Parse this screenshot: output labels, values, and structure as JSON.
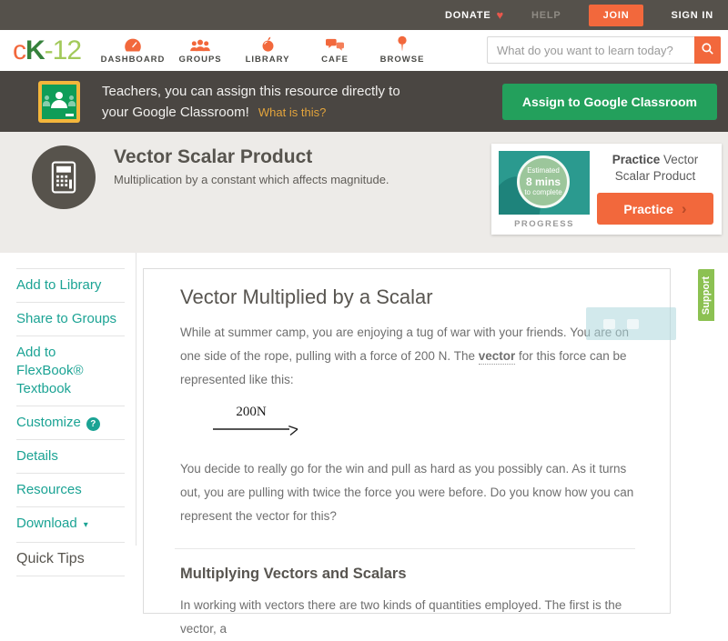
{
  "topbar": {
    "donate_label": "DONATE",
    "heart_icon": "♥",
    "help_label": "HELP",
    "join_label": "JOIN",
    "signin_label": "SIGN IN"
  },
  "nav": {
    "logo": {
      "c": "c",
      "k": "K",
      "suffix": "-12"
    },
    "items": [
      {
        "label": "DASHBOARD",
        "icon": "dashboard-icon"
      },
      {
        "label": "GROUPS",
        "icon": "groups-icon"
      },
      {
        "label": "LIBRARY",
        "icon": "library-icon"
      },
      {
        "label": "CAFE",
        "icon": "cafe-icon"
      },
      {
        "label": "BROWSE",
        "icon": "browse-icon"
      }
    ],
    "search": {
      "placeholder": "What do you want to learn today?"
    }
  },
  "classroom_banner": {
    "message_line1": "Teachers, you can assign this resource directly to",
    "message_line2": "your Google Classroom!",
    "link_label": "What is this?",
    "assign_button_label": "Assign to Google Classroom"
  },
  "lesson_header": {
    "title": "Vector Scalar Product",
    "subtitle": "Multiplication by a constant which affects magnitude."
  },
  "practice_card": {
    "badge_line1": "Estimated",
    "badge_line2": "8 mins",
    "badge_line3": "to complete",
    "progress_label": "PROGRESS",
    "title_bold": "Practice",
    "title_rest": " Vector Scalar Product",
    "button_label": "Practice",
    "button_chevron": "›"
  },
  "sidebar": {
    "items": [
      {
        "label": "Add to Library"
      },
      {
        "label": "Share to Groups"
      },
      {
        "label": "Add to FlexBook® Textbook"
      },
      {
        "label": "Customize",
        "badge": "?"
      },
      {
        "label": "Details"
      },
      {
        "label": "Resources"
      },
      {
        "label": "Download",
        "caret": "▾"
      },
      {
        "label": "Quick Tips"
      }
    ]
  },
  "article": {
    "heading": "Vector Multiplied by a Scalar",
    "p1_before": "While at summer camp, you are enjoying a tug of war with your friends. You are on one side of the rope, pulling with a force of 200 N. The ",
    "p1_term": "vector",
    "p1_after": " for this force can be represented like this:",
    "figure_label": "200N",
    "p2": "You decide to really go for the win and pull as hard as you possibly can. As it turns out, you are pulling with twice the force you were before. Do you know how you can represent the vector for this?",
    "section_heading": "Multiplying Vectors and Scalars",
    "p3": "In working with vectors there are two kinds of quantities employed. The first is the vector, a"
  },
  "support_tab": {
    "label": "Support"
  },
  "colors": {
    "accent_orange": "#F2683C",
    "classroom_button_green": "#23A05C",
    "link_teal": "#1BA394",
    "support_green": "#8CC152",
    "classroom_gold": "#F4B63B",
    "classroom_green": "#0F9D58",
    "heart_red": "#E8574C",
    "topbar_bg": "#55514B",
    "banner_bg": "#4A4642",
    "header_bg": "#EDEBE8",
    "practice_thumb_teal": "#2B9A8F"
  }
}
